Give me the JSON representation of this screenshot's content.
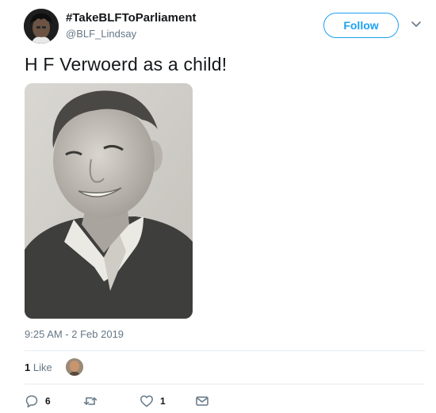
{
  "author": {
    "display_name": "#TakeBLFToParliament",
    "handle": "@BLF_Lindsay"
  },
  "header": {
    "follow_label": "Follow",
    "menu_icon": "chevron-down-icon"
  },
  "tweet": {
    "text": "H F Verwoerd as a child!",
    "timestamp": "9:25 AM - 2 Feb 2019"
  },
  "stats": {
    "likes_count": "1",
    "likes_label": "Like"
  },
  "actions": {
    "reply_count": "6",
    "retweet_count": "",
    "like_count": "1"
  },
  "colors": {
    "accent": "#1da1f2",
    "secondary_text": "#657786",
    "divider": "#e6ecf0"
  }
}
